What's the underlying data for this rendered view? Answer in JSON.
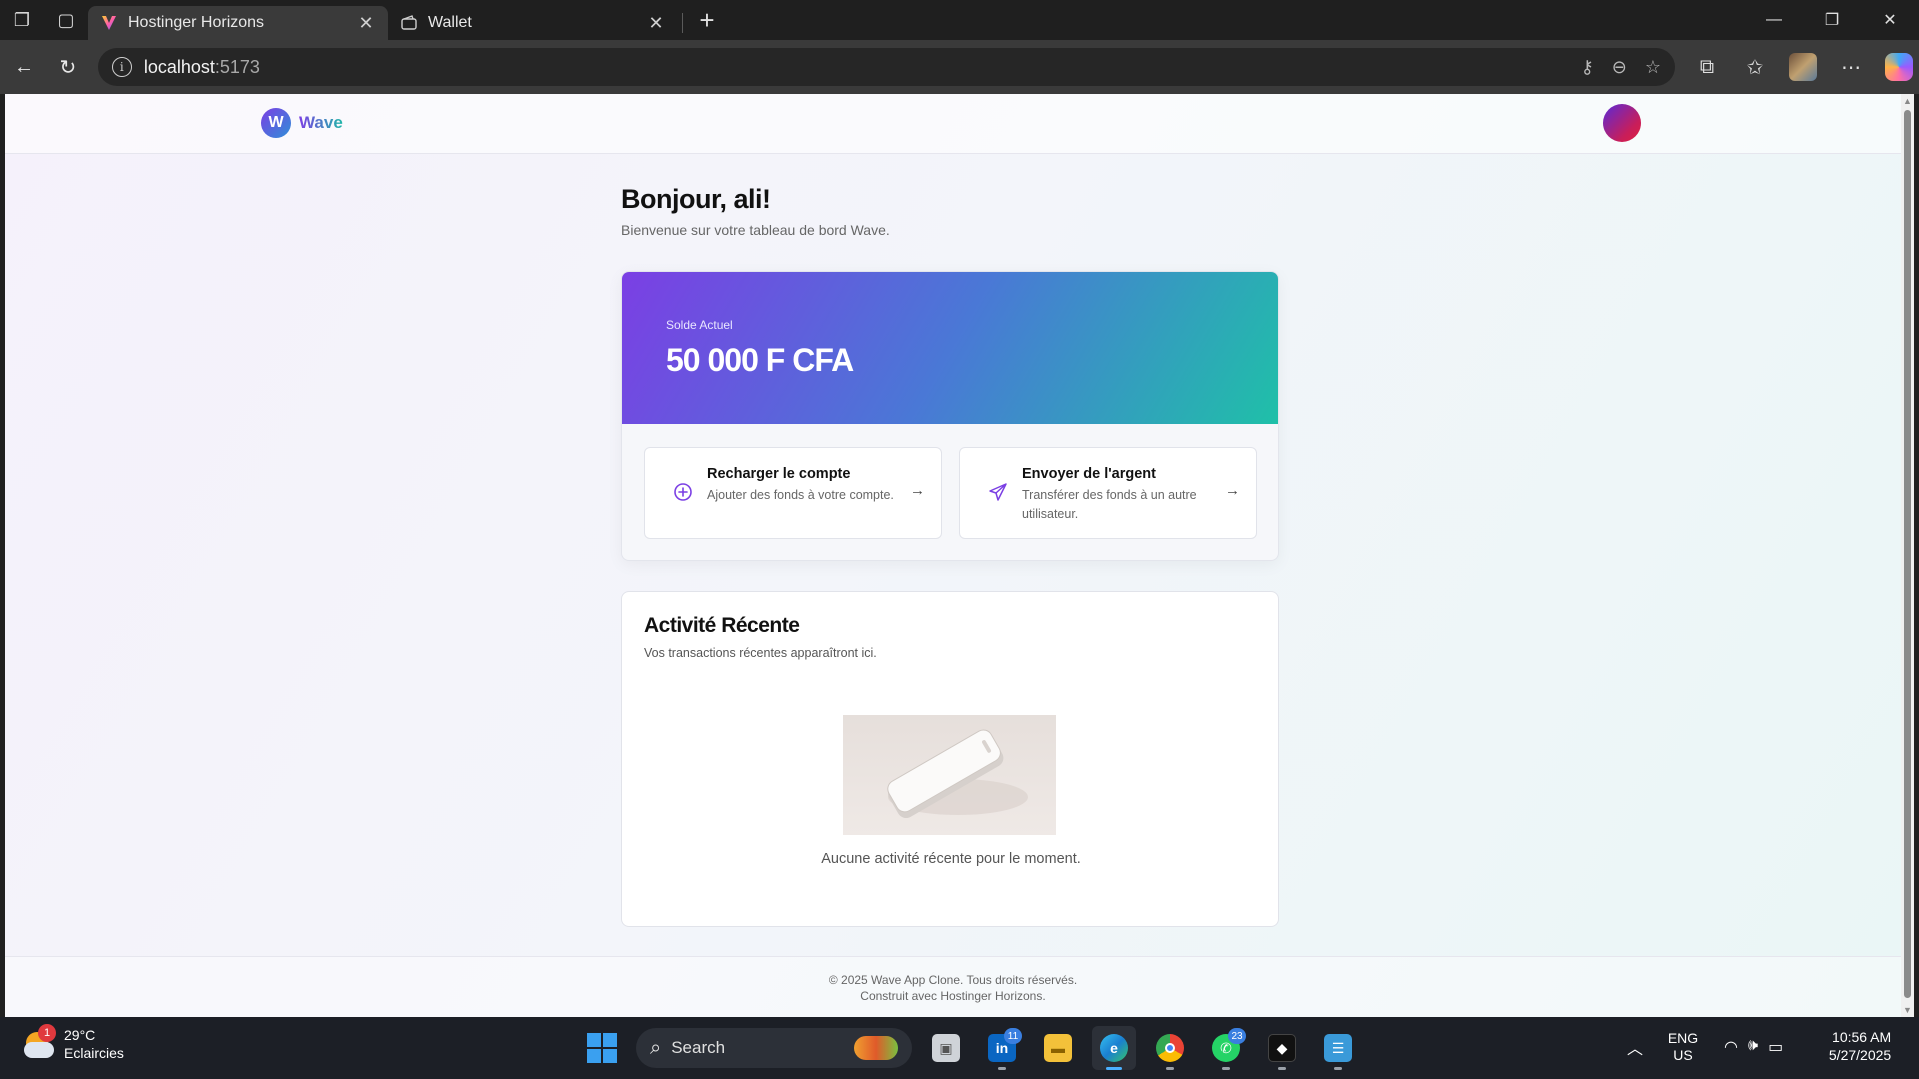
{
  "browser": {
    "tabs": [
      {
        "title": "Hostinger Horizons",
        "active": true
      },
      {
        "title": "Wallet",
        "active": false
      }
    ],
    "url_host": "localhost",
    "url_port": ":5173"
  },
  "app": {
    "logo_letter": "W",
    "logo_name": "Wave",
    "greeting": "Bonjour, ali!",
    "greeting_sub": "Bienvenue sur votre tableau de bord Wave.",
    "balance": {
      "label": "Solde Actuel",
      "amount": "50 000 F CFA"
    },
    "actions": [
      {
        "title": "Recharger le compte",
        "desc": "Ajouter des fonds à votre compte.",
        "icon": "plus-circle-icon"
      },
      {
        "title": "Envoyer de l'argent",
        "desc": "Transférer des fonds à un autre utilisateur.",
        "icon": "send-icon"
      }
    ],
    "activity": {
      "title": "Activité Récente",
      "subtitle": "Vos transactions récentes apparaîtront ici.",
      "empty_text": "Aucune activité récente pour le moment."
    },
    "footer": {
      "line1": "© 2025 Wave App Clone. Tous droits réservés.",
      "line2": "Construit avec Hostinger Horizons."
    },
    "colors": {
      "accent": "#7b3fe4",
      "teal": "#1fc0a8"
    }
  },
  "taskbar": {
    "weather": {
      "temp": "29°C",
      "desc": "Eclaircies",
      "badge": "1"
    },
    "search_label": "Search",
    "apps": [
      {
        "name": "task-view",
        "badge": ""
      },
      {
        "name": "linkedin",
        "badge": "11"
      },
      {
        "name": "file-explorer",
        "badge": ""
      },
      {
        "name": "edge",
        "badge": ""
      },
      {
        "name": "chrome",
        "badge": ""
      },
      {
        "name": "whatsapp",
        "badge": "23"
      },
      {
        "name": "terminal",
        "badge": ""
      },
      {
        "name": "notepad",
        "badge": ""
      }
    ],
    "lang_line1": "ENG",
    "lang_line2": "US",
    "time": "10:56 AM",
    "date": "5/27/2025"
  }
}
